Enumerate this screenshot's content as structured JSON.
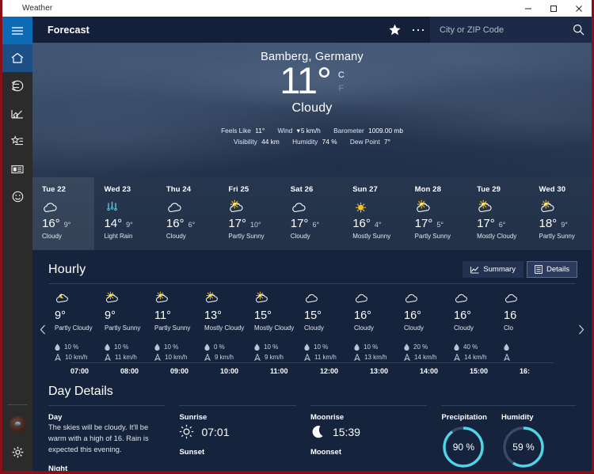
{
  "window": {
    "app_title": "Weather",
    "minimize": "–",
    "maximize": "☐",
    "close": "✕"
  },
  "sidebar": {
    "items": [
      {
        "name": "menu",
        "icon": "hamburger-icon"
      },
      {
        "name": "home",
        "icon": "home-icon"
      },
      {
        "name": "maps",
        "icon": "globe-icon"
      },
      {
        "name": "historical-weather",
        "icon": "chart-icon"
      },
      {
        "name": "favorites",
        "icon": "star-list-icon"
      },
      {
        "name": "news",
        "icon": "news-icon"
      },
      {
        "name": "send-feedback",
        "icon": "smiley-icon"
      }
    ],
    "bottom": [
      {
        "name": "account",
        "icon": "avatar-icon"
      },
      {
        "name": "settings",
        "icon": "gear-icon"
      }
    ]
  },
  "header": {
    "page_title": "Forecast",
    "favorite_icon": "star-icon",
    "more_icon": "ellipsis-icon",
    "more_label": "···",
    "search_placeholder": "City or ZIP Code",
    "search_value": "",
    "search_icon": "search-icon"
  },
  "hero": {
    "location": "Bamberg, Germany",
    "temperature": "11°",
    "unit_celsius": "C",
    "unit_fahrenheit": "F",
    "selected_unit": "C",
    "condition": "Cloudy",
    "stats_row1": [
      {
        "key": "Feels Like",
        "value": "11°"
      },
      {
        "key": "Wind",
        "value": "5 km/h",
        "icon": "wind-direction-icon"
      },
      {
        "key": "Barometer",
        "value": "1009.00 mb"
      }
    ],
    "stats_row2": [
      {
        "key": "Visibility",
        "value": "44 km"
      },
      {
        "key": "Humidity",
        "value": "74 %"
      },
      {
        "key": "Dew Point",
        "value": "7°"
      }
    ]
  },
  "daily": [
    {
      "day": "Tue 22",
      "icon": "cloudy",
      "high": "16°",
      "low": "9°",
      "condition": "Cloudy",
      "selected": true
    },
    {
      "day": "Wed 23",
      "icon": "light-rain",
      "high": "14°",
      "low": "9°",
      "condition": "Light Rain",
      "selected": false
    },
    {
      "day": "Thu 24",
      "icon": "cloudy",
      "high": "16°",
      "low": "6°",
      "condition": "Cloudy",
      "selected": false
    },
    {
      "day": "Fri 25",
      "icon": "partly-sunny",
      "high": "17°",
      "low": "10°",
      "condition": "Partly Sunny",
      "selected": false
    },
    {
      "day": "Sat 26",
      "icon": "cloudy",
      "high": "17°",
      "low": "6°",
      "condition": "Cloudy",
      "selected": false
    },
    {
      "day": "Sun 27",
      "icon": "sunny",
      "high": "16°",
      "low": "4°",
      "condition": "Mostly Sunny",
      "selected": false
    },
    {
      "day": "Mon 28",
      "icon": "partly-sunny",
      "high": "17°",
      "low": "5°",
      "condition": "Partly Sunny",
      "selected": false
    },
    {
      "day": "Tue 29",
      "icon": "partly-sunny",
      "high": "17°",
      "low": "6°",
      "condition": "Mostly Cloudy",
      "selected": false
    },
    {
      "day": "Wed 30",
      "icon": "partly-sunny",
      "high": "18°",
      "low": "9°",
      "condition": "Partly Sunny",
      "selected": false
    }
  ],
  "hourly_section": {
    "title": "Hourly",
    "summary_label": "Summary",
    "details_label": "Details",
    "active_view": "Details",
    "summary_icon": "line-chart-icon",
    "details_icon": "list-icon",
    "prev_icon": "chevron-left-icon",
    "next_icon": "chevron-right-icon"
  },
  "hourly": [
    {
      "time": "07:00",
      "icon": "partly-cloudy-night",
      "temp": "9°",
      "condition": "Partly Cloudy",
      "precip": "10 %",
      "wind": "10 km/h"
    },
    {
      "time": "08:00",
      "icon": "partly-sunny",
      "temp": "9°",
      "condition": "Partly Sunny",
      "precip": "10 %",
      "wind": "11 km/h"
    },
    {
      "time": "09:00",
      "icon": "partly-sunny",
      "temp": "11°",
      "condition": "Partly Sunny",
      "precip": "10 %",
      "wind": "10 km/h"
    },
    {
      "time": "10:00",
      "icon": "partly-sunny",
      "temp": "13°",
      "condition": "Mostly Cloudy",
      "precip": "0 %",
      "wind": "9 km/h"
    },
    {
      "time": "11:00",
      "icon": "partly-sunny",
      "temp": "15°",
      "condition": "Mostly Cloudy",
      "precip": "10 %",
      "wind": "9 km/h"
    },
    {
      "time": "12:00",
      "icon": "cloudy",
      "temp": "15°",
      "condition": "Cloudy",
      "precip": "10 %",
      "wind": "11 km/h"
    },
    {
      "time": "13:00",
      "icon": "cloudy",
      "temp": "16°",
      "condition": "Cloudy",
      "precip": "10 %",
      "wind": "13 km/h"
    },
    {
      "time": "14:00",
      "icon": "cloudy",
      "temp": "16°",
      "condition": "Cloudy",
      "precip": "20 %",
      "wind": "14 km/h"
    },
    {
      "time": "15:00",
      "icon": "cloudy",
      "temp": "16°",
      "condition": "Cloudy",
      "precip": "40 %",
      "wind": "14 km/h"
    },
    {
      "time": "16:",
      "icon": "cloudy",
      "temp": "16",
      "condition": "Clo",
      "precip": "",
      "wind": ""
    }
  ],
  "day_details": {
    "title": "Day Details",
    "day_heading": "Day",
    "day_text": "The skies will be cloudy. It'll be warm with a high of 16. Rain is expected this evening.",
    "night_heading": "Night",
    "sunrise_label": "Sunrise",
    "sunrise_time": "07:01",
    "sunrise_icon": "sun-icon",
    "sunset_label": "Sunset",
    "moonrise_label": "Moonrise",
    "moonrise_time": "15:39",
    "moonrise_icon": "moon-icon",
    "moonset_label": "Moonset",
    "precipitation_label": "Precipitation",
    "precipitation_value": "90 %",
    "precipitation_pct": 90,
    "humidity_label": "Humidity",
    "humidity_value": "59 %",
    "humidity_pct": 59
  },
  "colors": {
    "accent_cyan": "#4FD4E8",
    "ring_track": "#3a4a66",
    "sidebar_active": "#0d6ab5",
    "title_bar": "#ffffff",
    "content_bg": "#16233c",
    "sun_yellow": "#F2C31C"
  }
}
